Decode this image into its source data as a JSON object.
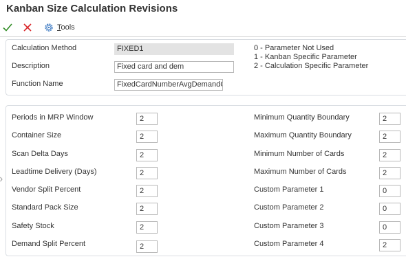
{
  "header": {
    "title": "Kanban Size Calculation Revisions"
  },
  "toolbar": {
    "ok_icon": "checkmark-icon",
    "cancel_icon": "x-icon",
    "tools_icon": "gear-icon",
    "tools_label_first": "T",
    "tools_label_rest": "ools",
    "colors": {
      "ok": "#2e8b22",
      "cancel": "#d9262a",
      "tools": "#3a78c2"
    }
  },
  "definition": {
    "calculation_method": {
      "label": "Calculation Method",
      "value": "FIXED1"
    },
    "description": {
      "label": "Description",
      "value": "Fixed card and dem"
    },
    "function_name": {
      "label": "Function Name",
      "value": "FixedCardNumberAvgDemandC"
    },
    "legend": [
      "0 - Parameter Not Used",
      "1 - Kanban Specific Parameter",
      "2 - Calculation Specific Parameter"
    ]
  },
  "parameters": {
    "left": [
      {
        "label": "Periods in MRP Window",
        "value": "2"
      },
      {
        "label": "Container Size",
        "value": "2"
      },
      {
        "label": "Scan Delta Days",
        "value": "2"
      },
      {
        "label": "Leadtime Delivery (Days)",
        "value": "2"
      },
      {
        "label": "Vendor Split Percent",
        "value": "2"
      },
      {
        "label": "Standard Pack Size",
        "value": "2"
      },
      {
        "label": "Safety Stock",
        "value": "2"
      },
      {
        "label": "Demand Split Percent",
        "value": "2"
      }
    ],
    "right": [
      {
        "label": "Minimum Quantity Boundary",
        "value": "2"
      },
      {
        "label": "Maximum Quantity Boundary",
        "value": "2"
      },
      {
        "label": "Minimum Number of Cards",
        "value": "2"
      },
      {
        "label": "Maximum Number of Cards",
        "value": "2"
      },
      {
        "label": "Custom Parameter 1",
        "value": "0"
      },
      {
        "label": "Custom Parameter 2",
        "value": "0"
      },
      {
        "label": "Custom Parameter 3",
        "value": "0"
      },
      {
        "label": "Custom Parameter 4",
        "value": "2"
      }
    ]
  }
}
